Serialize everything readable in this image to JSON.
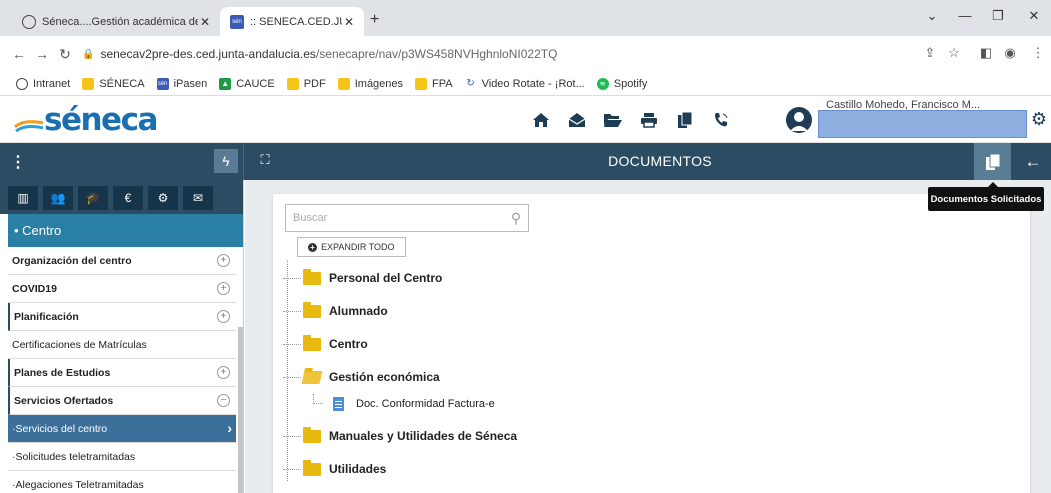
{
  "browser": {
    "tabs": [
      {
        "title": "Séneca....Gestión académica de l",
        "active": false
      },
      {
        "title": ":: SENECA.CED.JUNTA DE ANDALU",
        "active": true
      }
    ],
    "new_tab": "+",
    "url_host": "senecav2pre-des.ced.junta-andalucia.es",
    "url_path": "/senecapre/nav/p3WS458NVHghnloNI022TQ",
    "bookmarks": [
      {
        "label": "Intranet",
        "icon": "globe-icon"
      },
      {
        "label": "SÉNECA",
        "icon": "folder-icon"
      },
      {
        "label": "iPasen",
        "icon": "ipasen-icon"
      },
      {
        "label": "CAUCE",
        "icon": "cauce-icon"
      },
      {
        "label": "PDF",
        "icon": "folder-icon"
      },
      {
        "label": "Imágenes",
        "icon": "folder-icon"
      },
      {
        "label": "FPA",
        "icon": "folder-icon"
      },
      {
        "label": "Video Rotate - ¡Rot...",
        "icon": "video-rotate-icon"
      },
      {
        "label": "Spotify",
        "icon": "spotify-icon"
      }
    ],
    "favicon_small": "sén"
  },
  "app": {
    "logo_text": "séneca",
    "user_name_partial": "Castillo Mohedo, Francisco M..."
  },
  "toolbar": {
    "page_title": "DOCUMENTOS",
    "tooltip": "Documentos Solicitados"
  },
  "sidebar": {
    "section_title": "• Centro",
    "items": [
      {
        "label": "Organización del centro",
        "bold": true,
        "expand": "+"
      },
      {
        "label": "COVID19",
        "bold": true,
        "expand": "+"
      },
      {
        "label": "Planificación",
        "bold": true,
        "expand": "+"
      },
      {
        "label": "Certificaciones de Matrículas",
        "bold": false,
        "expand": ""
      },
      {
        "label": "Planes de Estudios",
        "bold": true,
        "expand": "+"
      },
      {
        "label": "Servicios Ofertados",
        "bold": true,
        "expand": "−"
      },
      {
        "label": "·Servicios del centro",
        "bold": false,
        "expand": ""
      },
      {
        "label": "·Solicitudes teletramitadas",
        "bold": false,
        "expand": ""
      },
      {
        "label": "·Alegaciones Teletramitadas",
        "bold": false,
        "expand": ""
      }
    ]
  },
  "main": {
    "search_placeholder": "Buscar",
    "expand_all_label": "EXPANDIR TODO",
    "tree": [
      {
        "label": "Personal del Centro"
      },
      {
        "label": "Alumnado"
      },
      {
        "label": "Centro"
      },
      {
        "label": "Gestión económica"
      },
      {
        "label": "Doc. Conformidad Factura-e"
      },
      {
        "label": "Manuales y Utilidades de Séneca"
      },
      {
        "label": "Utilidades"
      }
    ]
  },
  "colors": {
    "toolbar": "#2c4c63",
    "sidebar_section": "#2a7fa4",
    "active_item": "#3d6f9b",
    "folder": "#e8b90f",
    "user_box": "#8eaee0"
  }
}
